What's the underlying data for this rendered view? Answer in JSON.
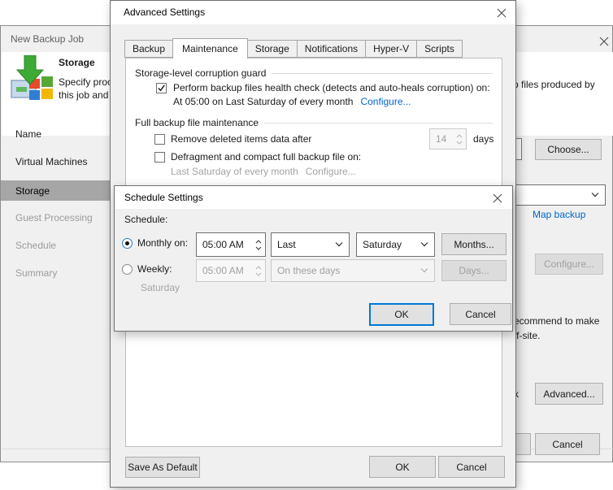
{
  "background_window": {
    "title": "New Backup Job",
    "header": {
      "step_title": "Storage",
      "desc_left_line1": "Specify proc",
      "desc_left_line2": "this job and",
      "desc_right_fragment": "p files produced by"
    },
    "sidebar": {
      "items": [
        {
          "label": "Name",
          "state": "done"
        },
        {
          "label": "Virtual Machines",
          "state": "done"
        },
        {
          "label": "Storage",
          "state": "active"
        },
        {
          "label": "Guest Processing",
          "state": "pending"
        },
        {
          "label": "Schedule",
          "state": "pending"
        },
        {
          "label": "Summary",
          "state": "pending"
        }
      ]
    },
    "controls": {
      "choose_button": "Choose...",
      "map_backup_link": "Map backup",
      "configure_button_disabled": "Configure...",
      "advanced_button": "Advanced...",
      "cancel_button": "Cancel"
    },
    "text_fragments": {
      "fragment_1": "ecommend to make",
      "fragment_2": "ff-site.",
      "fragment_3": "k"
    }
  },
  "advanced_dialog": {
    "title": "Advanced Settings",
    "tabs": [
      "Backup",
      "Maintenance",
      "Storage",
      "Notifications",
      "Hyper-V",
      "Scripts"
    ],
    "active_tab": "Maintenance",
    "corruption_guard": {
      "caption": "Storage-level corruption guard",
      "health_check_label": "Perform backup files health check (detects and auto-heals corruption) on:",
      "health_check_checked": true,
      "schedule_text": "At 05:00 on Last Saturday of every month",
      "configure_link": "Configure..."
    },
    "full_backup_maintenance": {
      "caption": "Full backup file maintenance",
      "remove_label": "Remove deleted items data after",
      "remove_checked": false,
      "days_value": "14",
      "days_label": "days",
      "defrag_label": "Defragment and compact full backup file on:",
      "defrag_checked": false,
      "defrag_schedule": "Last Saturday of every month",
      "defrag_configure": "Configure..."
    },
    "buttons": {
      "save_default": "Save As Default",
      "ok": "OK",
      "cancel": "Cancel"
    }
  },
  "schedule_dialog": {
    "title": "Schedule Settings",
    "schedule_label": "Schedule:",
    "monthly": {
      "radio_label": "Monthly on:",
      "selected": true,
      "time_value": "05:00 AM",
      "week_number": "Last",
      "weekday": "Saturday",
      "months_button": "Months..."
    },
    "weekly": {
      "radio_label": "Weekly:",
      "selected": false,
      "time_value": "05:00 AM",
      "days_combo_value": "On these days",
      "days_button": "Days...",
      "summary_text": "Saturday"
    },
    "buttons": {
      "ok": "OK",
      "cancel": "Cancel"
    }
  },
  "colors": {
    "accent": "#0078d7",
    "link_blue": "#0066cc",
    "dialog_bg": "#f0f0f0",
    "titlebar_bg": "#ffffff",
    "sidebar_selected": "#a6a6a6",
    "disabled_text": "#a3a3a3",
    "button_face": "#e1e1e1",
    "button_border": "#adadad",
    "green_arrow": "#3daa35"
  }
}
